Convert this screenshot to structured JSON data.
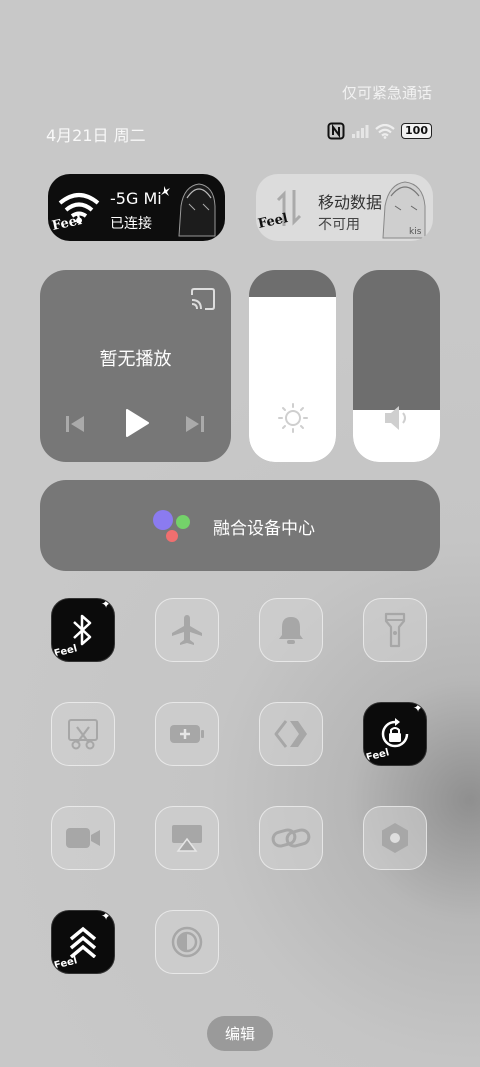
{
  "status_bar": {
    "emergency_text": "仅可紧急通话",
    "date": "4月21日 周二",
    "battery": "100",
    "icons": [
      "nfc-icon",
      "signal-icon",
      "wifi-icon",
      "battery-icon"
    ]
  },
  "wifi_card": {
    "ssid": "-5G  Mi",
    "status": "已连接",
    "sticker_text": "Feel"
  },
  "data_card": {
    "title": "移动数据",
    "status": "不可用",
    "sticker_text": "Feel"
  },
  "media": {
    "title": "暂无播放"
  },
  "sliders": {
    "brightness_level": 0.86,
    "volume_level": 0.27
  },
  "fusion": {
    "label": "融合设备中心"
  },
  "tiles": [
    {
      "name": "bluetooth",
      "active": true
    },
    {
      "name": "airplane",
      "active": false
    },
    {
      "name": "mute",
      "active": false
    },
    {
      "name": "flashlight",
      "active": false
    },
    {
      "name": "screenshot",
      "active": false
    },
    {
      "name": "battery-saver",
      "active": false
    },
    {
      "name": "nearby-share",
      "active": false
    },
    {
      "name": "rotation-lock",
      "active": true
    },
    {
      "name": "screen-record",
      "active": false
    },
    {
      "name": "screen-cast",
      "active": false
    },
    {
      "name": "link",
      "active": false
    },
    {
      "name": "settings",
      "active": false
    },
    {
      "name": "performance",
      "active": true
    },
    {
      "name": "dark-mode",
      "active": false
    }
  ],
  "edit_button": "编辑",
  "colors": {
    "active_tile": "#0b0b0b",
    "panel": "#777777",
    "slider_fill": "#ffffff"
  }
}
